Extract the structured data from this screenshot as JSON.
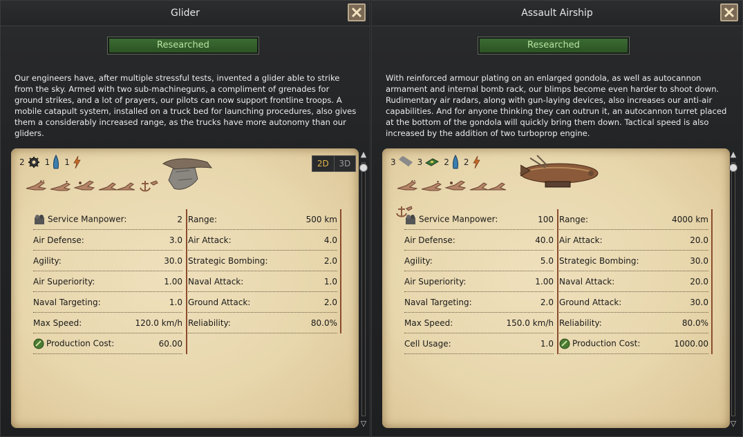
{
  "panels": [
    {
      "title": "Glider",
      "status": "Researched",
      "description": "Our engineers have, after multiple stressful tests, invented a glider able to strike from the sky. Armed with two sub-machineguns, a compliment of grenades for ground strikes, and a lot of prayers, our pilots can now support frontline troops. A mobile catapult system, installed on a truck bed for launching procedures, also gives them a considerably increased range, as the trucks have more autonomy than our gliders.",
      "resources": [
        {
          "count": "2",
          "icon": "gear-icon"
        },
        {
          "count": "1",
          "icon": "fuel-icon"
        },
        {
          "count": "1",
          "icon": "lightning-icon"
        }
      ],
      "view_toggle": {
        "option_2d": "2D",
        "option_3d": "3D"
      },
      "mission_icons": [
        "fighter-mission-icon",
        "cas-mission-icon",
        "bomber-mission-icon",
        "recon-mission-icon",
        "naval-strike-icon"
      ],
      "left_stats": [
        {
          "label": "Service Manpower:",
          "value": "2",
          "icon": "manpower-icon"
        },
        {
          "label": "Air Defense:",
          "value": "3.0"
        },
        {
          "label": "Agility:",
          "value": "30.0"
        },
        {
          "label": "Air Superiority:",
          "value": "1.00"
        },
        {
          "label": "Naval Targeting:",
          "value": "1.0"
        },
        {
          "label": "Max Speed:",
          "value": "120.0 km/h"
        },
        {
          "label": "Production Cost:",
          "value": "60.00",
          "icon": "production-icon"
        }
      ],
      "right_stats": [
        {
          "label": "Range:",
          "value": "500 km"
        },
        {
          "label": "Air Attack:",
          "value": "4.0"
        },
        {
          "label": "Strategic Bombing:",
          "value": "2.0"
        },
        {
          "label": "Naval Attack:",
          "value": "1.0"
        },
        {
          "label": "Ground Attack:",
          "value": "2.0"
        },
        {
          "label": "Reliability:",
          "value": "80.0%"
        }
      ]
    },
    {
      "title": "Assault Airship",
      "status": "Researched",
      "description": "With reinforced armour plating on an enlarged gondola, as well as autocannon armament and internal bomb rack, our blimps become even harder to shoot down. Rudimentary air radars, along with gun-laying devices, also increases our anti-air capabilities. And for anyone thinking they can outrun it, an autocannon turret placed at the bottom of the gondola will quickly bring them down. Tactical speed is also increased by the addition of two turboprop engine.",
      "resources": [
        {
          "count": "3",
          "icon": "steel-icon"
        },
        {
          "count": "3",
          "icon": "electronics-icon"
        },
        {
          "count": "2",
          "icon": "fuel-icon"
        },
        {
          "count": "2",
          "icon": "lightning-icon"
        }
      ],
      "mission_icons": [
        "fighter-mission-icon",
        "cas-mission-icon",
        "bomber-mission-icon",
        "recon-mission-icon",
        "naval-strike-icon",
        "anchor-icon"
      ],
      "left_stats": [
        {
          "label": "Service Manpower:",
          "value": "100",
          "icon": "manpower-icon"
        },
        {
          "label": "Air Defense:",
          "value": "40.0"
        },
        {
          "label": "Agility:",
          "value": "5.0"
        },
        {
          "label": "Air Superiority:",
          "value": "1.00"
        },
        {
          "label": "Naval Targeting:",
          "value": "2.0"
        },
        {
          "label": "Max Speed:",
          "value": "150.0 km/h"
        },
        {
          "label": "Cell Usage:",
          "value": "1.0"
        }
      ],
      "right_stats": [
        {
          "label": "Range:",
          "value": "4000 km"
        },
        {
          "label": "Air Attack:",
          "value": "20.0"
        },
        {
          "label": "Strategic Bombing:",
          "value": "30.0"
        },
        {
          "label": "Naval Attack:",
          "value": "20.0"
        },
        {
          "label": "Ground Attack:",
          "value": "30.0"
        },
        {
          "label": "Reliability:",
          "value": "80.0%"
        },
        {
          "label": "Production Cost:",
          "value": "1000.00",
          "icon": "production-icon"
        }
      ]
    }
  ]
}
